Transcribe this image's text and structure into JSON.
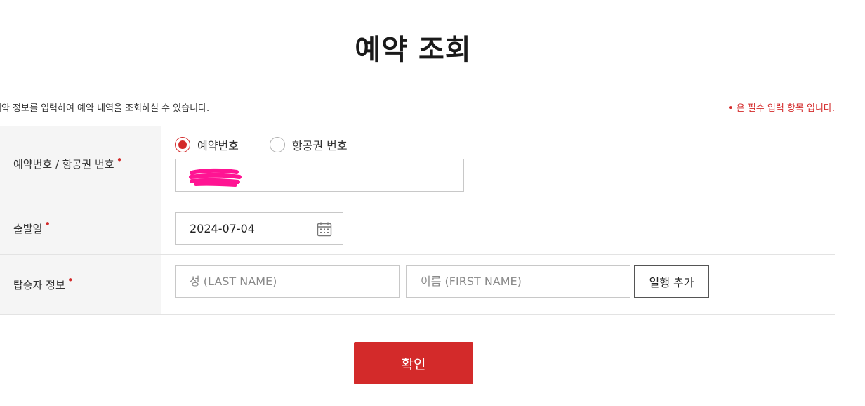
{
  "page": {
    "title": "예약 조회",
    "info_text": "예약 정보를 입력하여 예약 내역을 조회하실 수 있습니다.",
    "required_note": "• 은 필수 입력 항목 입니다."
  },
  "form": {
    "reservation": {
      "label": "예약번호 / 항공권 번호",
      "required_mark": "•",
      "options": [
        {
          "label": "예약번호",
          "checked": true
        },
        {
          "label": "항공권 번호",
          "checked": false
        }
      ],
      "value": ""
    },
    "departure": {
      "label": "출발일",
      "required_mark": "•",
      "value": "2024-07-04"
    },
    "passenger": {
      "label": "탑승자 정보",
      "required_mark": "•",
      "last_name_placeholder": "성 (LAST NAME)",
      "first_name_placeholder": "이름 (FIRST NAME)",
      "add_companion_label": "일행 추가"
    }
  },
  "actions": {
    "confirm_label": "확인"
  },
  "colors": {
    "accent": "#d32a2a",
    "redaction": "#ff1493"
  }
}
